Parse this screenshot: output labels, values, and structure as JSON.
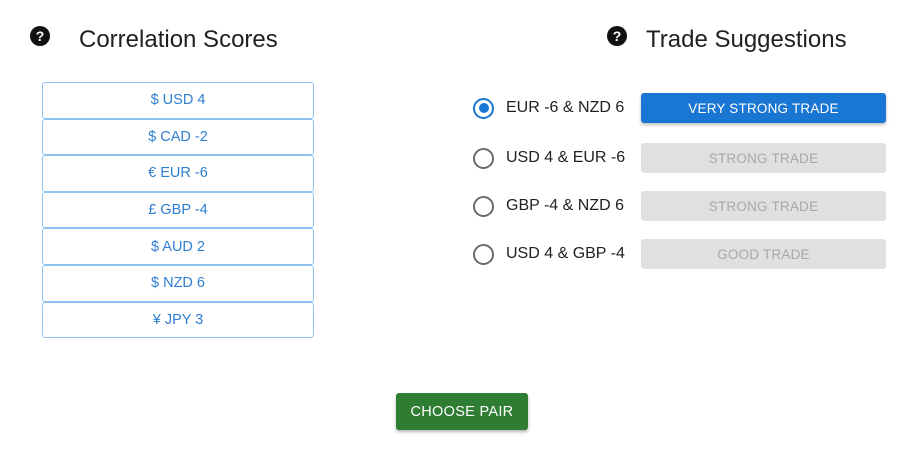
{
  "correlation": {
    "title": "Correlation Scores",
    "help_icon": "question-circle-icon",
    "items": [
      {
        "label": "$ USD 4"
      },
      {
        "label": "$ CAD -2"
      },
      {
        "label": "€ EUR -6"
      },
      {
        "label": "£ GBP -4"
      },
      {
        "label": "$ AUD 2"
      },
      {
        "label": "$ NZD 6"
      },
      {
        "label": "¥ JPY 3"
      }
    ]
  },
  "suggestions": {
    "title": "Trade Suggestions",
    "help_icon": "question-circle-icon",
    "items": [
      {
        "pair": "EUR -6 & NZD 6",
        "rating": "VERY STRONG TRADE",
        "selected": true
      },
      {
        "pair": "USD 4 & EUR -6",
        "rating": "STRONG TRADE",
        "selected": false
      },
      {
        "pair": "GBP -4 & NZD 6",
        "rating": "STRONG TRADE",
        "selected": false
      },
      {
        "pair": "USD 4 & GBP -4",
        "rating": "GOOD TRADE",
        "selected": false
      }
    ]
  },
  "actions": {
    "choose_label": "CHOOSE PAIR"
  },
  "colors": {
    "primary": "#1976d2",
    "success": "#2e7d32",
    "score_text": "#2f7fd1",
    "score_border": "#90c2ee",
    "disabled_bg": "#e0e0e0"
  }
}
